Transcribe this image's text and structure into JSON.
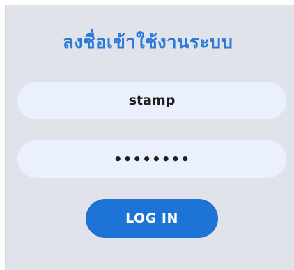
{
  "login_form": {
    "title": "ลงชื่อเข้าใช้งานระบบ",
    "username": {
      "value": "stamp"
    },
    "password": {
      "masked_value": "••••••••"
    },
    "submit_label": "LOG IN"
  },
  "colors": {
    "title": "#2b79d9",
    "panel_background": "#e1e3ea",
    "field_background": "#eaf0fd",
    "button_background": "#1e73d6",
    "button_text": "#ffffff"
  }
}
